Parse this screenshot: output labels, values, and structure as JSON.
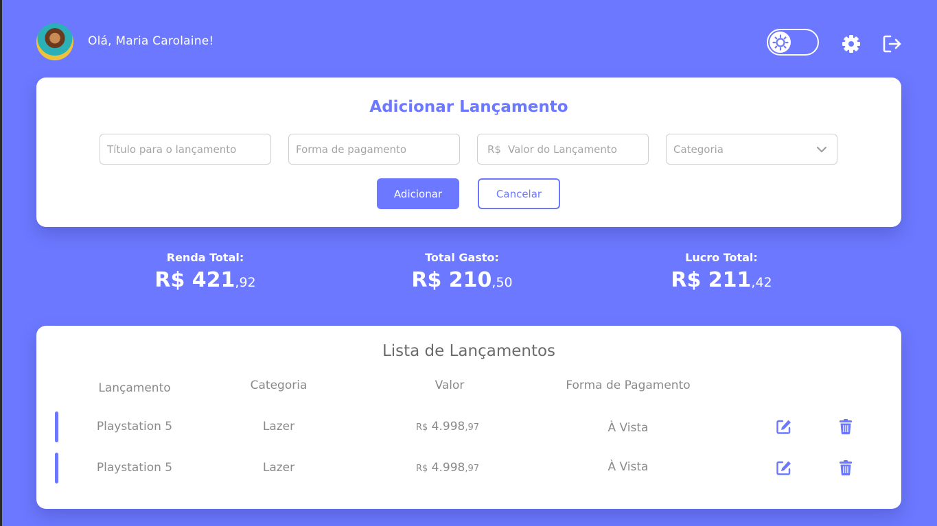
{
  "header": {
    "greeting": "Olá, Maria Carolaine!"
  },
  "add_form": {
    "title": "Adicionar Lançamento",
    "title_placeholder": "Título para o lançamento",
    "payment_placeholder": "Forma de pagamento",
    "value_prefix": "R$",
    "value_placeholder": "Valor do Lançamento",
    "category_placeholder": "Categoria",
    "add_label": "Adicionar",
    "cancel_label": "Cancelar"
  },
  "summary": [
    {
      "label": "Renda Total:",
      "currency": "R$",
      "whole": "421",
      "cents": ",92"
    },
    {
      "label": "Total Gasto:",
      "currency": "R$",
      "whole": "210",
      "cents": ",50"
    },
    {
      "label": "Lucro Total:",
      "currency": "R$",
      "whole": "211",
      "cents": ",42"
    }
  ],
  "list": {
    "title": "Lista de Lançamentos",
    "columns": [
      "Lançamento",
      "Categoria",
      "Valor",
      "Forma de Pagamento"
    ],
    "rows": [
      {
        "name": "Playstation 5",
        "category": "Lazer",
        "currency": "R$",
        "whole": "4.998",
        "cents": ",97",
        "payment": "À Vista"
      },
      {
        "name": "Playstation 5",
        "category": "Lazer",
        "currency": "R$",
        "whole": "4.998",
        "cents": ",97",
        "payment": "À Vista"
      }
    ]
  },
  "icons": {
    "theme": "sun-icon",
    "settings": "gear-icon",
    "logout": "logout-icon",
    "select": "chevron-down-icon",
    "edit": "edit-icon",
    "delete": "trash-icon"
  },
  "colors": {
    "accent": "#6c78ff",
    "card": "#ffffff",
    "text_muted": "#8a8a8a"
  }
}
